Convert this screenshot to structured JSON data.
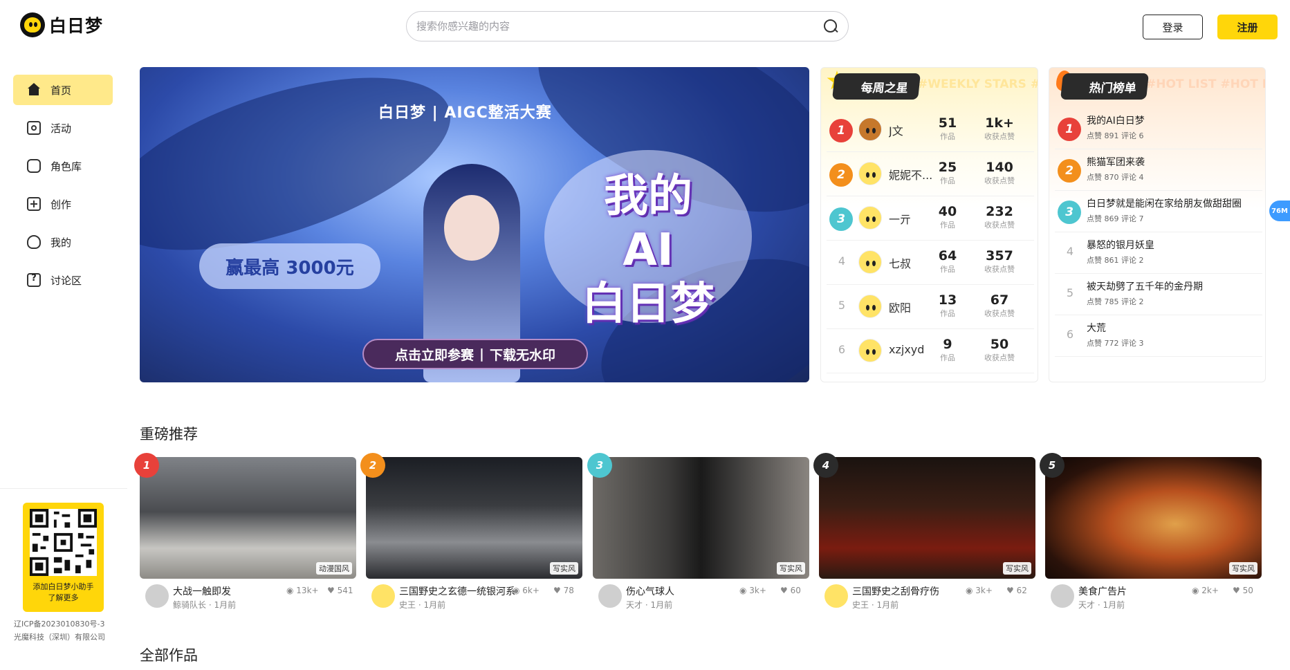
{
  "app": {
    "name": "白日梦"
  },
  "header": {
    "search_placeholder": "搜索你感兴趣的内容",
    "login_label": "登录",
    "register_label": "注册"
  },
  "sidebar": {
    "items": [
      {
        "label": "首页",
        "icon": "home-icon",
        "active": true
      },
      {
        "label": "活动",
        "icon": "event-icon"
      },
      {
        "label": "角色库",
        "icon": "character-icon"
      },
      {
        "label": "创作",
        "icon": "create-icon"
      },
      {
        "label": "我的",
        "icon": "bulb-icon"
      },
      {
        "label": "讨论区",
        "icon": "question-icon"
      }
    ],
    "qr_text_line1": "添加白日梦小助手",
    "qr_text_line2": "了解更多",
    "icp": "辽ICP备2023010830号-3",
    "company": "光魔科技（深圳）有限公司"
  },
  "banner": {
    "brand": "白日梦 | AIGC整活大赛",
    "prize": "赢最高 3000元",
    "title_line1": "我的",
    "title_line2": "AI",
    "title_line3": "白日梦",
    "cta_left": "点击立即参赛",
    "cta_right": "下载无水印"
  },
  "weekly_stars": {
    "title": "每周之星",
    "watermark": "#WEEKLY STARS #WEEKLY STARS #WEEK",
    "works_label": "作品",
    "likes_label": "收获点赞",
    "rows": [
      {
        "rank": "1",
        "name": "J文",
        "works": "51",
        "likes": "1k+"
      },
      {
        "rank": "2",
        "name": "妮妮不...",
        "works": "25",
        "likes": "140"
      },
      {
        "rank": "3",
        "name": "一亓",
        "works": "40",
        "likes": "232"
      },
      {
        "rank": "4",
        "name": "七叔",
        "works": "64",
        "likes": "357"
      },
      {
        "rank": "5",
        "name": "欧阳",
        "works": "13",
        "likes": "67"
      },
      {
        "rank": "6",
        "name": "xzjxyd",
        "works": "9",
        "likes": "50"
      }
    ]
  },
  "hot_list": {
    "title": "热门榜单",
    "watermark": "#HOT LIST #HOT LIST #HOT LIST",
    "rows": [
      {
        "rank": "1",
        "title": "我的AI白日梦",
        "meta": "点赞 891   评论 6"
      },
      {
        "rank": "2",
        "title": "熊猫军团来袭",
        "meta": "点赞 870   评论 4"
      },
      {
        "rank": "3",
        "title": "白日梦就是能闲在家给朋友做甜甜圈",
        "meta": "点赞 869   评论 7"
      },
      {
        "rank": "4",
        "title": "暴怒的银月妖皇",
        "meta": "点赞 861   评论 2"
      },
      {
        "rank": "5",
        "title": "被天劫劈了五千年的金丹期",
        "meta": "点赞 785   评论 2"
      },
      {
        "rank": "6",
        "title": "大荒",
        "meta": "点赞 772   评论 3"
      }
    ]
  },
  "side_pill": "76M",
  "recommend": {
    "title": "重磅推荐",
    "cards": [
      {
        "rank": "1",
        "tag": "动漫国风",
        "title": "大战一触即发",
        "author": "鲸骑队长 · 1月前",
        "views": "13k+",
        "likes": "541"
      },
      {
        "rank": "2",
        "tag": "写实风",
        "title": "三国野史之玄德一统银河系",
        "author": "史王 · 1月前",
        "views": "6k+",
        "likes": "78"
      },
      {
        "rank": "3",
        "tag": "写实风",
        "title": "伤心气球人",
        "author": "天才 · 1月前",
        "views": "3k+",
        "likes": "60"
      },
      {
        "rank": "4",
        "tag": "写实风",
        "title": "三国野史之刮骨疗伤",
        "author": "史王 · 1月前",
        "views": "3k+",
        "likes": "62"
      },
      {
        "rank": "5",
        "tag": "写实风",
        "title": "美食广告片",
        "author": "天才 · 1月前",
        "views": "2k+",
        "likes": "50"
      }
    ]
  },
  "all_works": {
    "title": "全部作品"
  },
  "colors": {
    "accent": "#ffd60a",
    "rank1": "#e8413a",
    "rank2": "#f38f1c",
    "rank3": "#4ec6d0",
    "rank4": "#2b2b2b",
    "rank5": "#2b2b2b"
  }
}
